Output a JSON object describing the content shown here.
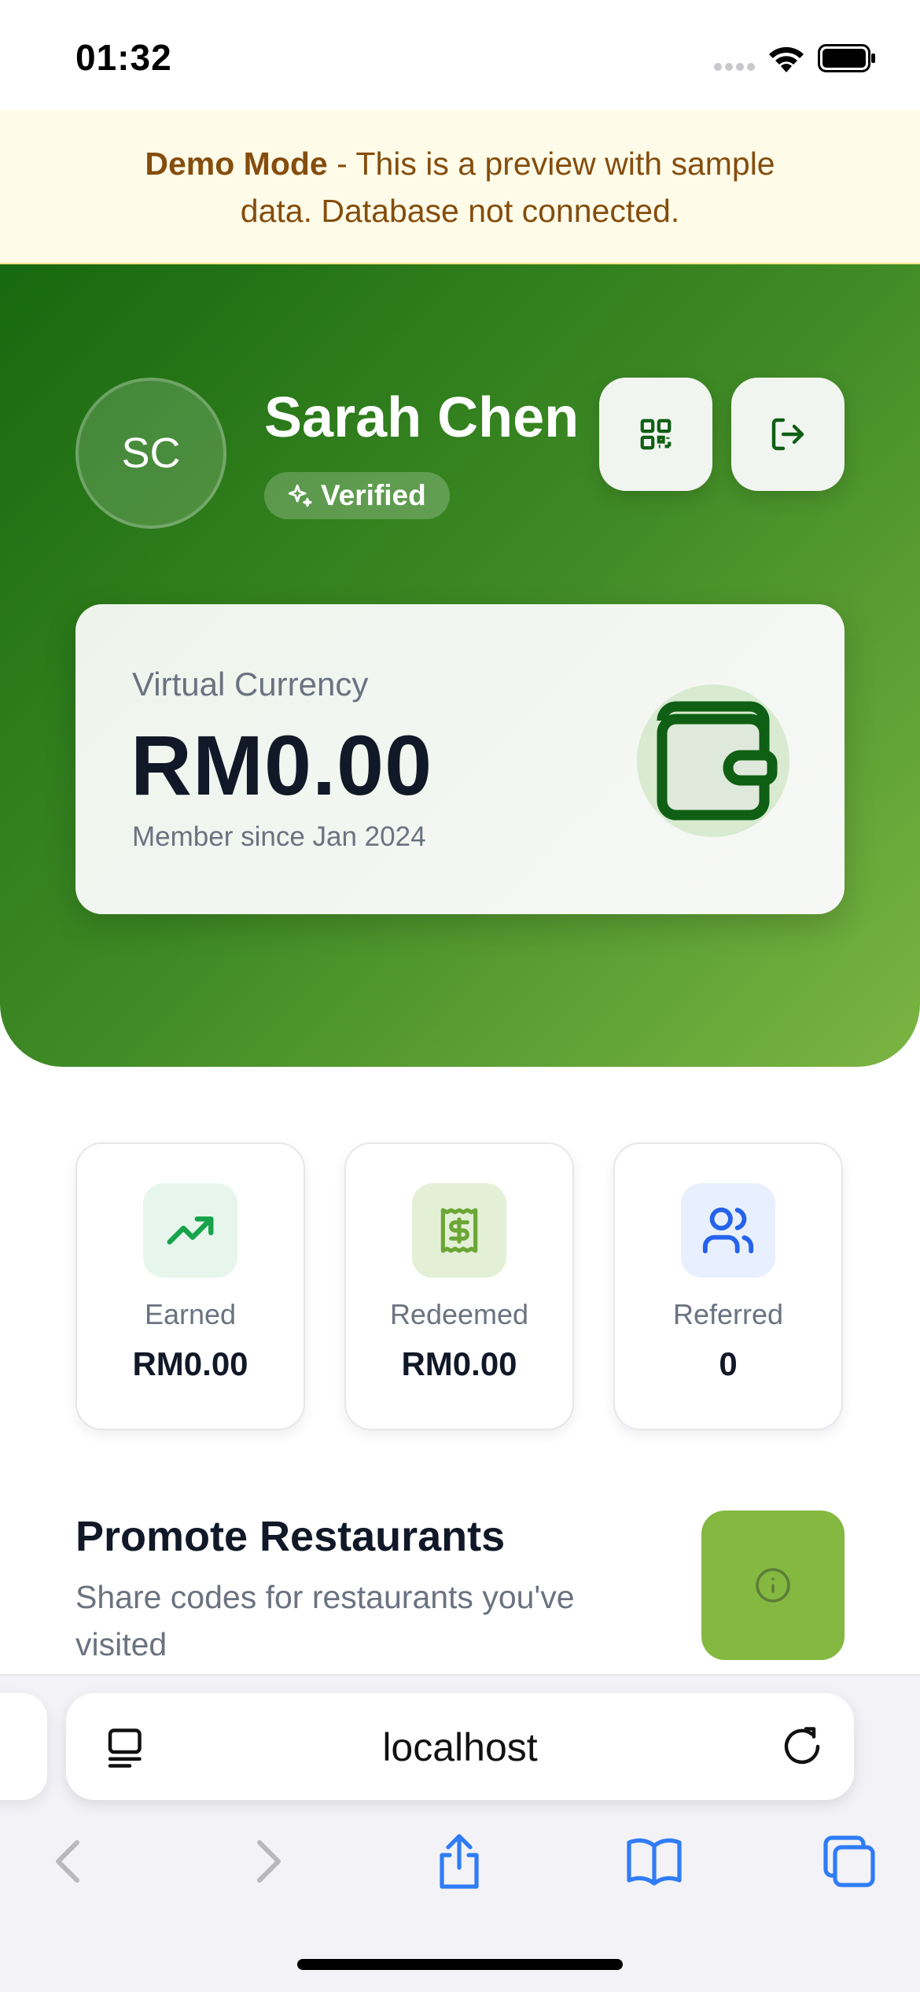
{
  "status_bar": {
    "time": "01:32"
  },
  "demo_banner": {
    "bold": "Demo Mode",
    "line1_rest": " - This is a preview with sample",
    "line2": "data. Database not connected."
  },
  "profile": {
    "initials": "SC",
    "name": "Sarah Chen",
    "badge": "Verified"
  },
  "wallet": {
    "label": "Virtual Currency",
    "amount": "RM0.00",
    "member_since": "Member since Jan 2024"
  },
  "stats": [
    {
      "label": "Earned",
      "value": "RM0.00",
      "icon": "trending-up-icon",
      "bg": "#e6f6ec",
      "color": "#16a34a"
    },
    {
      "label": "Redeemed",
      "value": "RM0.00",
      "icon": "receipt-icon",
      "bg": "#e3f0d6",
      "color": "#6ba637"
    },
    {
      "label": "Referred",
      "value": "0",
      "icon": "users-icon",
      "bg": "#e8efff",
      "color": "#2563eb"
    }
  ],
  "promote": {
    "title": "Promote Restaurants",
    "subtitle": "Share codes for restaurants you've visited"
  },
  "browser": {
    "url": "localhost"
  },
  "colors": {
    "brand_green": "#17690f",
    "accent_lime": "#84b840",
    "safari_blue": "#2f7cf6"
  }
}
